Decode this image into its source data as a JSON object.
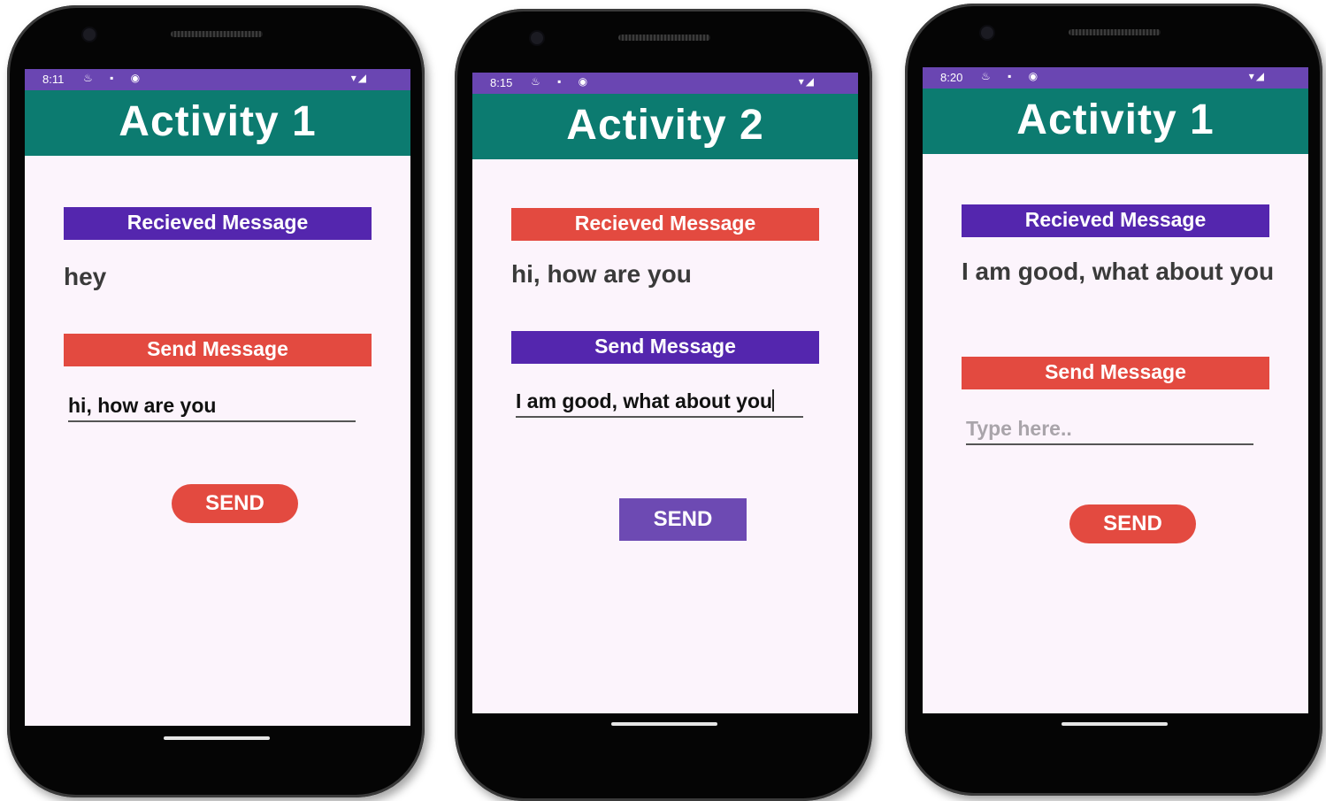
{
  "phones": [
    {
      "status_time": "8:11",
      "status_icons_left": "♨ ▪ ◉",
      "status_icons_right": "▾◢",
      "title": "Activity 1",
      "received_label": "Recieved Message",
      "received_text": "hey",
      "send_label": "Send Message",
      "input_value": "hi, how are you",
      "input_placeholder": "",
      "send_button_label": "SEND",
      "colors": {
        "received_label_bg": "#5426ae",
        "send_label_bg": "#e34a40",
        "send_button_bg": "#e34a40"
      }
    },
    {
      "status_time": "8:15",
      "status_icons_left": "♨ ▪ ◉",
      "status_icons_right": "▾◢",
      "title": "Activity 2",
      "received_label": "Recieved Message",
      "received_text": "hi, how are you",
      "send_label": "Send Message",
      "input_value": "I am good, what about you",
      "input_placeholder": "",
      "send_button_label": "SEND",
      "colors": {
        "received_label_bg": "#e34a40",
        "send_label_bg": "#5426ae",
        "send_button_bg": "#6d4ab3"
      }
    },
    {
      "status_time": "8:20",
      "status_icons_left": "♨ ▪ ◉",
      "status_icons_right": "▾◢",
      "title": "Activity 1",
      "received_label": "Recieved Message",
      "received_text": "I am good, what about you",
      "send_label": "Send Message",
      "input_value": "",
      "input_placeholder": "Type here..",
      "send_button_label": "SEND",
      "colors": {
        "received_label_bg": "#5426ae",
        "send_label_bg": "#e34a40",
        "send_button_bg": "#e34a40"
      }
    }
  ],
  "colors": {
    "status_bar": "#6a46b2",
    "app_bar": "#0c7b70",
    "screen_bg": "#fcf4fc"
  }
}
